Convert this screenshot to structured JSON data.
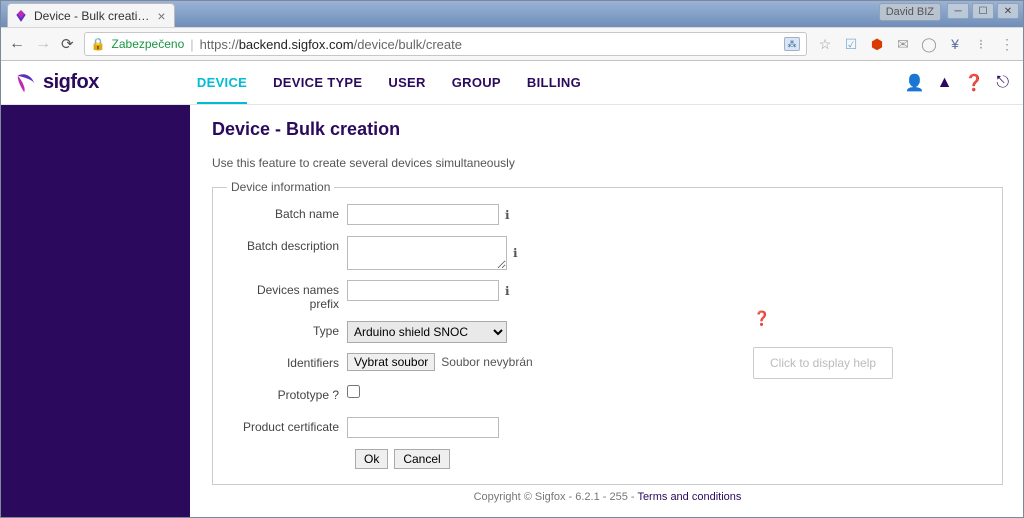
{
  "browser": {
    "tab_title": "Device - Bulk creati…",
    "user_label": "David BIZ",
    "secure_label": "Zabezpečeno",
    "url_prefix": "https://",
    "url_domain": "backend.sigfox.com",
    "url_path": "/device/bulk/create"
  },
  "header": {
    "brand": "sigfox",
    "nav": {
      "device": "DEVICE",
      "device_type": "DEVICE TYPE",
      "user": "USER",
      "group": "GROUP",
      "billing": "BILLING"
    }
  },
  "page_title": "Device - Bulk creation",
  "subtitle": "Use this feature to create several devices simultaneously",
  "fieldset_legend": "Device information",
  "form": {
    "batch_name_label": "Batch name",
    "batch_description_label": "Batch description",
    "prefix_label": "Devices names prefix",
    "type_label": "Type",
    "type_value": "Arduino shield SNOC",
    "identifiers_label": "Identifiers",
    "file_button": "Vybrat soubor",
    "file_status": "Soubor nevybrán",
    "prototype_label": "Prototype ?",
    "product_cert_label": "Product certificate",
    "help_box": "Click to display help",
    "ok": "Ok",
    "cancel": "Cancel"
  },
  "footer": {
    "copyright": "Copyright © Sigfox - 6.2.1 - 255 - ",
    "terms": "Terms and conditions"
  }
}
